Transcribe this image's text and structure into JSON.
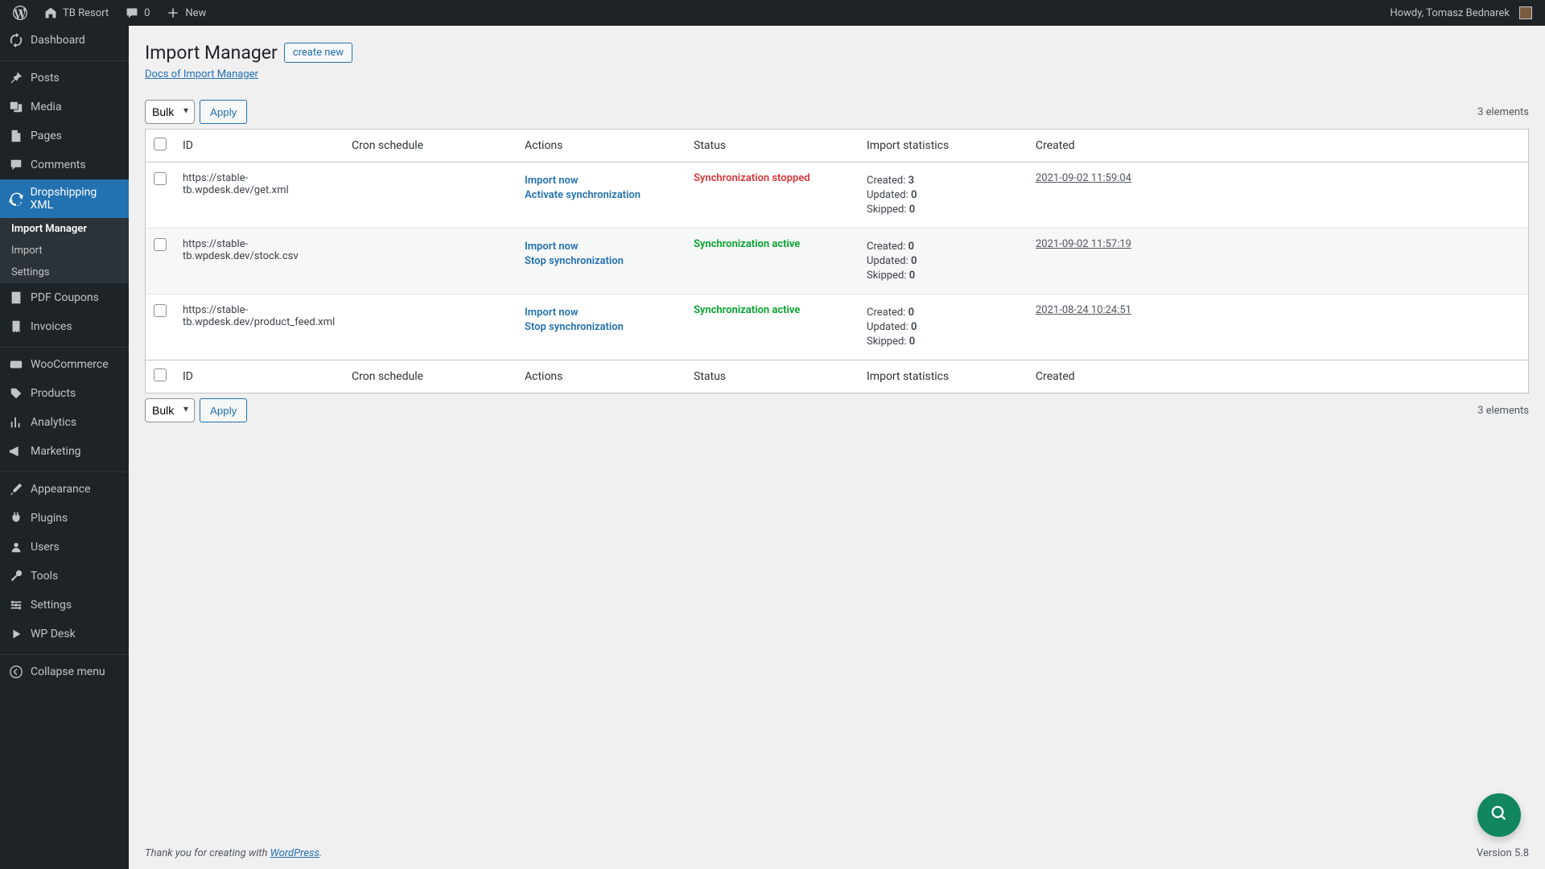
{
  "adminbar": {
    "site_name": "TB Resort",
    "comments_count": "0",
    "new_label": "New",
    "howdy": "Howdy, Tomasz Bednarek"
  },
  "sidebar": {
    "dashboard": "Dashboard",
    "posts": "Posts",
    "media": "Media",
    "pages": "Pages",
    "comments": "Comments",
    "dropshipping": "Dropshipping XML",
    "sub_import_manager": "Import Manager",
    "sub_import": "Import",
    "sub_settings": "Settings",
    "pdf_coupons": "PDF Coupons",
    "invoices": "Invoices",
    "woocommerce": "WooCommerce",
    "products": "Products",
    "analytics": "Analytics",
    "marketing": "Marketing",
    "appearance": "Appearance",
    "plugins": "Plugins",
    "users": "Users",
    "tools": "Tools",
    "settings": "Settings",
    "wp_desk": "WP Desk",
    "collapse": "Collapse menu"
  },
  "page": {
    "title": "Import Manager",
    "create_new": "create new",
    "docs_link": "Docs of Import Manager",
    "bulk_label": "Bulk",
    "apply": "Apply",
    "elements_count": "3 elements"
  },
  "columns": {
    "id": "ID",
    "cron": "Cron schedule",
    "actions": "Actions",
    "status": "Status",
    "stats": "Import statistics",
    "created": "Created"
  },
  "labels": {
    "import_now": "Import now",
    "activate_sync": "Activate synchronization",
    "stop_sync": "Stop synchronization",
    "created_l": "Created:",
    "updated_l": "Updated:",
    "skipped_l": "Skipped:",
    "status_stopped": "Synchronization stopped",
    "status_active": "Synchronization active"
  },
  "rows": [
    {
      "url": "https://stable-tb.wpdesk.dev/get.xml",
      "status": "stopped",
      "created_n": "3",
      "updated_n": "0",
      "skipped_n": "0",
      "created_ts": "2021-09-02 11:59:04"
    },
    {
      "url": "https://stable-tb.wpdesk.dev/stock.csv",
      "status": "active",
      "created_n": "0",
      "updated_n": "0",
      "skipped_n": "0",
      "created_ts": "2021-09-02 11:57:19"
    },
    {
      "url": "https://stable-tb.wpdesk.dev/product_feed.xml",
      "status": "active",
      "created_n": "0",
      "updated_n": "0",
      "skipped_n": "0",
      "created_ts": "2021-08-24 10:24:51"
    }
  ],
  "footer": {
    "thanks_prefix": "Thank you for creating with ",
    "wordpress": "WordPress",
    "version": "Version 5.8"
  }
}
